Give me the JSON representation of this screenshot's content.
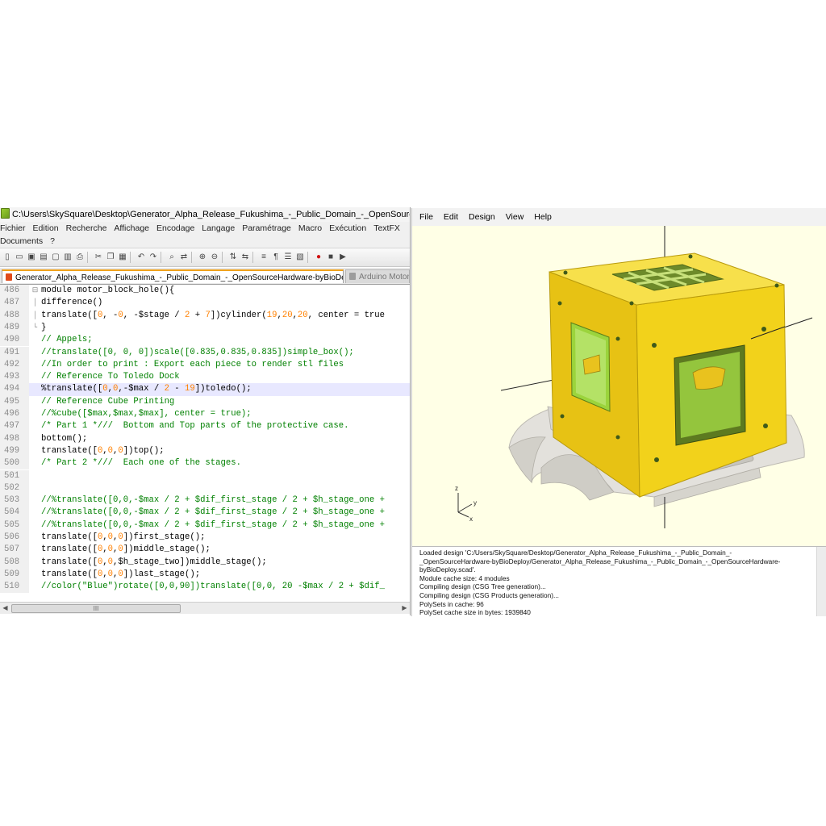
{
  "npp": {
    "title": "C:\\Users\\SkySquare\\Desktop\\Generator_Alpha_Release_Fukushima_-_Public_Domain_-_OpenSourceHardware-",
    "menu_row1": [
      "Fichier",
      "Edition",
      "Recherche",
      "Affichage",
      "Encodage",
      "Langage",
      "Paramétrage",
      "Macro",
      "Exécution",
      "TextFX"
    ],
    "menu_row2": [
      "Documents",
      "?"
    ],
    "tabs": {
      "active": "Generator_Alpha_Release_Fukushima_-_Public_Domain_-_OpenSourceHardware-byBioDeploy.scad",
      "inactive": "Arduino Motor C"
    },
    "lines": [
      {
        "n": "486",
        "fold": "⊟",
        "segs": [
          {
            "t": "module motor_block_hole(){",
            "c": "kw"
          }
        ]
      },
      {
        "n": "487",
        "fold": "│",
        "segs": [
          {
            "t": "difference()",
            "c": "kw"
          }
        ]
      },
      {
        "n": "488",
        "fold": "│",
        "segs": [
          {
            "t": "translate([",
            "c": "kw"
          },
          {
            "t": "0",
            "c": "num"
          },
          {
            "t": ", -",
            "c": "kw"
          },
          {
            "t": "0",
            "c": "num"
          },
          {
            "t": ", -$stage / ",
            "c": "kw"
          },
          {
            "t": "2",
            "c": "num"
          },
          {
            "t": " + ",
            "c": "kw"
          },
          {
            "t": "7",
            "c": "num"
          },
          {
            "t": "])cylinder(",
            "c": "kw"
          },
          {
            "t": "19",
            "c": "num"
          },
          {
            "t": ",",
            "c": "kw"
          },
          {
            "t": "20",
            "c": "num"
          },
          {
            "t": ",",
            "c": "kw"
          },
          {
            "t": "20",
            "c": "num"
          },
          {
            "t": ", center = true",
            "c": "kw"
          }
        ]
      },
      {
        "n": "489",
        "fold": "└",
        "segs": [
          {
            "t": "}",
            "c": "kw"
          }
        ]
      },
      {
        "n": "490",
        "fold": "",
        "segs": [
          {
            "t": "// Appels;",
            "c": "com"
          }
        ]
      },
      {
        "n": "491",
        "fold": "",
        "segs": [
          {
            "t": "//translate([0, 0, 0])scale([0.835,0.835,0.835])simple_box();",
            "c": "com"
          }
        ]
      },
      {
        "n": "492",
        "fold": "",
        "segs": [
          {
            "t": "//In order to print : Export each piece to render stl files",
            "c": "com"
          }
        ]
      },
      {
        "n": "493",
        "fold": "",
        "segs": [
          {
            "t": "// Reference To Toledo Dock",
            "c": "com"
          }
        ]
      },
      {
        "n": "494",
        "fold": "",
        "hl": true,
        "segs": [
          {
            "t": "%translate([",
            "c": "kw"
          },
          {
            "t": "0",
            "c": "num"
          },
          {
            "t": ",",
            "c": "kw"
          },
          {
            "t": "0",
            "c": "num"
          },
          {
            "t": ",-$max / ",
            "c": "kw"
          },
          {
            "t": "2",
            "c": "num"
          },
          {
            "t": " - ",
            "c": "kw"
          },
          {
            "t": "19",
            "c": "num"
          },
          {
            "t": "])toledo();",
            "c": "kw"
          }
        ]
      },
      {
        "n": "495",
        "fold": "",
        "segs": [
          {
            "t": "// Reference Cube Printing",
            "c": "com"
          }
        ]
      },
      {
        "n": "496",
        "fold": "",
        "segs": [
          {
            "t": "//%cube([$max,$max,$max], center = true);",
            "c": "com"
          }
        ]
      },
      {
        "n": "497",
        "fold": "",
        "segs": [
          {
            "t": "/* Part 1 *///  Bottom and Top parts of the protective case.",
            "c": "com"
          }
        ]
      },
      {
        "n": "498",
        "fold": "",
        "segs": [
          {
            "t": "bottom();",
            "c": "kw"
          }
        ]
      },
      {
        "n": "499",
        "fold": "",
        "segs": [
          {
            "t": "translate([",
            "c": "kw"
          },
          {
            "t": "0",
            "c": "num"
          },
          {
            "t": ",",
            "c": "kw"
          },
          {
            "t": "0",
            "c": "num"
          },
          {
            "t": ",",
            "c": "kw"
          },
          {
            "t": "0",
            "c": "num"
          },
          {
            "t": "])top();",
            "c": "kw"
          }
        ]
      },
      {
        "n": "500",
        "fold": "",
        "segs": [
          {
            "t": "/* Part 2 *///  Each one of the stages.",
            "c": "com"
          }
        ]
      },
      {
        "n": "501",
        "fold": "",
        "segs": [
          {
            "t": "",
            "c": "kw"
          }
        ]
      },
      {
        "n": "502",
        "fold": "",
        "segs": [
          {
            "t": "",
            "c": "kw"
          }
        ]
      },
      {
        "n": "503",
        "fold": "",
        "segs": [
          {
            "t": "//%translate([0,0,-$max / 2 + $dif_first_stage / 2 + $h_stage_one +",
            "c": "com"
          }
        ]
      },
      {
        "n": "504",
        "fold": "",
        "segs": [
          {
            "t": "//%translate([0,0,-$max / 2 + $dif_first_stage / 2 + $h_stage_one +",
            "c": "com"
          }
        ]
      },
      {
        "n": "505",
        "fold": "",
        "segs": [
          {
            "t": "//%translate([0,0,-$max / 2 + $dif_first_stage / 2 + $h_stage_one +",
            "c": "com"
          }
        ]
      },
      {
        "n": "506",
        "fold": "",
        "segs": [
          {
            "t": "translate([",
            "c": "kw"
          },
          {
            "t": "0",
            "c": "num"
          },
          {
            "t": ",",
            "c": "kw"
          },
          {
            "t": "0",
            "c": "num"
          },
          {
            "t": ",",
            "c": "kw"
          },
          {
            "t": "0",
            "c": "num"
          },
          {
            "t": "])first_stage();",
            "c": "kw"
          }
        ]
      },
      {
        "n": "507",
        "fold": "",
        "segs": [
          {
            "t": "translate([",
            "c": "kw"
          },
          {
            "t": "0",
            "c": "num"
          },
          {
            "t": ",",
            "c": "kw"
          },
          {
            "t": "0",
            "c": "num"
          },
          {
            "t": ",",
            "c": "kw"
          },
          {
            "t": "0",
            "c": "num"
          },
          {
            "t": "])middle_stage();",
            "c": "kw"
          }
        ]
      },
      {
        "n": "508",
        "fold": "",
        "segs": [
          {
            "t": "translate([",
            "c": "kw"
          },
          {
            "t": "0",
            "c": "num"
          },
          {
            "t": ",",
            "c": "kw"
          },
          {
            "t": "0",
            "c": "num"
          },
          {
            "t": ",$h_stage_two])middle_stage();",
            "c": "kw"
          }
        ]
      },
      {
        "n": "509",
        "fold": "",
        "segs": [
          {
            "t": "translate([",
            "c": "kw"
          },
          {
            "t": "0",
            "c": "num"
          },
          {
            "t": ",",
            "c": "kw"
          },
          {
            "t": "0",
            "c": "num"
          },
          {
            "t": ",",
            "c": "kw"
          },
          {
            "t": "0",
            "c": "num"
          },
          {
            "t": "])last_stage();",
            "c": "kw"
          }
        ]
      },
      {
        "n": "510",
        "fold": "",
        "segs": [
          {
            "t": "//color(\"Blue\")rotate([0,0,90])translate([0,0, 20 -$max / 2 + $dif_",
            "c": "com"
          }
        ]
      }
    ],
    "scroll_thumb_label": "III"
  },
  "scad": {
    "menu": [
      "File",
      "Edit",
      "Design",
      "View",
      "Help"
    ],
    "axes": {
      "x": "x",
      "y": "y",
      "z": "z"
    },
    "console": [
      "Loaded design 'C:/Users/SkySquare/Desktop/Generator_Alpha_Release_Fukushima_-_Public_Domain_-",
      "_OpenSourceHardware-byBioDeploy/Generator_Alpha_Release_Fukushima_-_Public_Domain_-_OpenSourceHardware-",
      "byBioDeploy.scad'.",
      "Module cache size: 4 modules",
      "Compiling design (CSG Tree generation)...",
      "Compiling design (CSG Products generation)...",
      "PolySets in cache: 96",
      "PolySet cache size in bytes: 1939840"
    ]
  },
  "colors": {
    "comment": "#008000",
    "number": "#ff8000",
    "model_yellow_front": "#f2d21b",
    "model_yellow_side": "#e7c214",
    "model_yellow_top": "#f7e04b",
    "green_window": "#9bd43c",
    "dock_grey": "#e3e1dc",
    "viewport_bg": "#ffffe6",
    "tab_accent": "#f0a11a"
  }
}
